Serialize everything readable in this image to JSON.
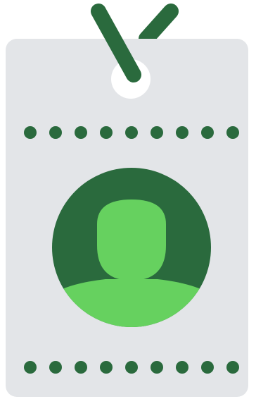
{
  "icon": {
    "name": "id-badge-icon",
    "colors": {
      "card": "#E3E5E8",
      "dark_green": "#2A6A3D",
      "light_green": "#66D15F",
      "hole": "#FFFFFF"
    },
    "top_dots": 9,
    "bottom_dots": 9
  }
}
